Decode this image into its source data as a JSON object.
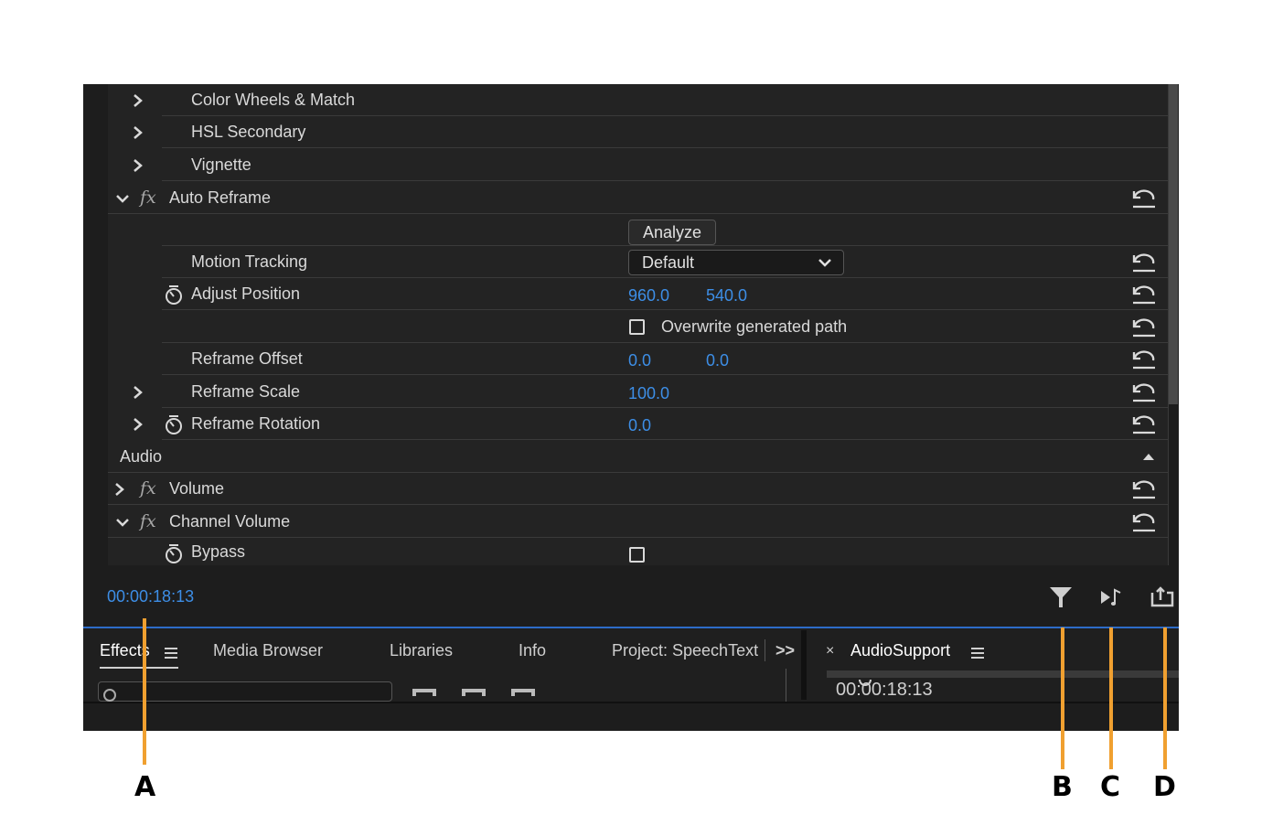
{
  "effects": {
    "color_wheels_match": "Color Wheels & Match",
    "hsl_secondary": "HSL Secondary",
    "vignette": "Vignette",
    "auto_reframe": "Auto Reframe",
    "analyze_button": "Analyze",
    "motion_tracking": "Motion Tracking",
    "motion_tracking_value": "Default",
    "adjust_position": "Adjust Position",
    "adjust_position_x": "960.0",
    "adjust_position_y": "540.0",
    "overwrite_path": "Overwrite generated path",
    "reframe_offset": "Reframe Offset",
    "reframe_offset_x": "0.0",
    "reframe_offset_y": "0.0",
    "reframe_scale": "Reframe Scale",
    "reframe_scale_value": "100.0",
    "reframe_rotation": "Reframe Rotation",
    "reframe_rotation_value": "0.0",
    "audio_section": "Audio",
    "volume": "Volume",
    "channel_volume": "Channel Volume",
    "bypass": "Bypass",
    "fx_symbol": "fx"
  },
  "footer": {
    "timecode": "00:00:18:13"
  },
  "tabs": {
    "effects": "Effects",
    "media_browser": "Media Browser",
    "libraries": "Libraries",
    "info": "Info",
    "project": "Project: SpeechText",
    "overflow": ">>",
    "close": "×",
    "audio_support": "AudioSupport",
    "audio_support_timecode": "00:00:18:13"
  },
  "callouts": {
    "a": "A",
    "b": "B",
    "c": "C",
    "d": "D"
  },
  "colors": {
    "accent": "#3d8ee6",
    "callout": "#f0a030",
    "panel": "#232323"
  }
}
